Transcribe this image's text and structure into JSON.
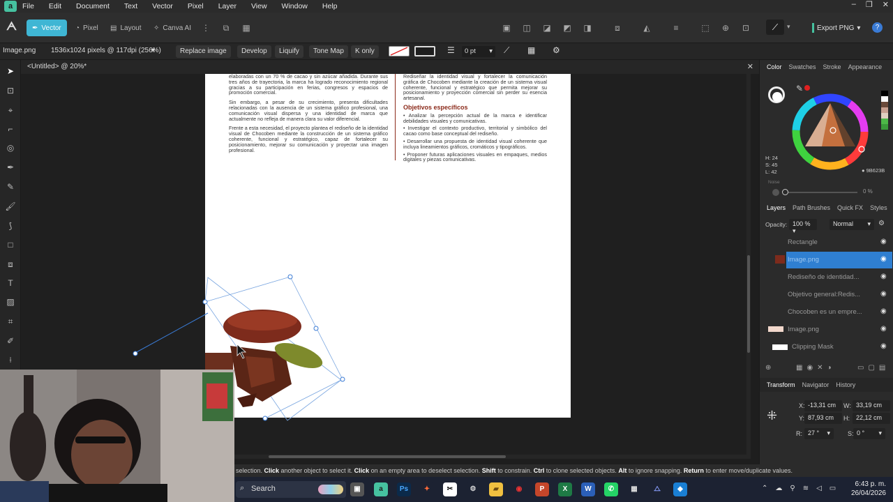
{
  "menubar": {
    "items": [
      "File",
      "Edit",
      "Document",
      "Text",
      "Vector",
      "Pixel",
      "Layer",
      "View",
      "Window",
      "Help"
    ],
    "window_controls": [
      "–",
      "❐",
      "✕"
    ]
  },
  "toolbar": {
    "personas": [
      "Vector",
      "Pixel",
      "Layout",
      "Canva AI"
    ],
    "export_label": "Export PNG"
  },
  "contextbar": {
    "layer_name": "Image.png",
    "dimensions": "1536x1024 pixels @ 117dpi (256%)",
    "replace_image": "Replace image",
    "develop": "Develop",
    "liquify": "Liquify",
    "tone_map": "Tone Map",
    "k_only": "K only",
    "stroke_width": "0 pt"
  },
  "doctab": {
    "title": "<Untitled> @ 20%*",
    "close": "✕"
  },
  "page": {
    "left_col": [
      "elaboradas con un 70 % de cacao y sin azúcar añadida. Durante sus tres años de trayectoria, la marca ha logrado reconocimiento regional gracias a su participación en ferias, congresos y espacios de promoción comercial.",
      "Sin embargo, a pesar de su crecimiento, presenta dificultades relacionadas con la ausencia de un sistema gráfico profesional, una comunicación visual dispersa y una identidad de marca que actualmente no refleja de manera clara su valor diferencial.",
      "Frente a esta necesidad, el proyecto plantea el rediseño de la identidad visual de Chocoben mediante la construcción de un sistema gráfico coherente, funcional y estratégico, capaz de fortalecer su posicionamiento, mejorar su comunicación y proyectar una imagen profesional."
    ],
    "right_top": "Rediseñar la identidad visual y fortalecer la comunicación gráfica de Chocoben mediante la creación de un sistema visual coherente, funcional y estratégico que permita mejorar su posicionamiento y proyección comercial sin perder su esencia artesanal.",
    "objectives_title": "Objetivos específicos",
    "objectives": [
      "• Analizar la percepción actual de la marca e identificar debilidades visuales y comunicativas.",
      "• Investigar el contexto productivo, territorial y simbólico del cacao como base conceptual del rediseño.",
      "• Desarrollar una propuesta de identidad visual coherente que incluya lineamientos gráficos, cromáticos y tipográficos.",
      "• Proponer futuras aplicaciones visuales en empaques, medios digitales y piezas comunicativas."
    ]
  },
  "color_panel": {
    "tabs": [
      "Color",
      "Swatches",
      "Stroke",
      "Appearance"
    ],
    "h": "H: 24",
    "s": "S: 45",
    "l": "L: 42",
    "hex": "9B623B",
    "noise_label": "Noise",
    "noise_value": "0 %",
    "accent": "#9b623b"
  },
  "layers_panel": {
    "tabs": [
      "Layers",
      "Path Brushes",
      "Quick FX",
      "Styles"
    ],
    "opacity_label": "Opacity:",
    "opacity_value": "100 %",
    "blend_mode": "Normal",
    "layers": [
      "Rectangle",
      "Image.png",
      "Rediseño de identidad...",
      "Objetivo general:Redis...",
      "Chocoben es un empre...",
      "Image.png",
      "Clipping Mask"
    ]
  },
  "transform_panel": {
    "tabs": [
      "Transform",
      "Navigator",
      "History"
    ],
    "x_label": "X:",
    "x": "-13,31 cm",
    "w_label": "W:",
    "w": "33,19 cm",
    "y_label": "Y:",
    "y": "87,93 cm",
    "h_label": "H:",
    "h": "22,12 cm",
    "r_label": "R:",
    "r": "27 °",
    "s_label": "S:",
    "s": "0 °"
  },
  "statusbar": {
    "t1": "selection. ",
    "k1": "Click",
    "t2": " another object to select it. ",
    "k2": "Click",
    "t3": " on an empty area to deselect selection. ",
    "k3": "Shift",
    "t4": " to constrain. ",
    "k4": "Ctrl",
    "t5": " to clone selected objects. ",
    "k5": "Alt",
    "t6": " to ignore snapping. ",
    "k6": "Return",
    "t7": " to enter move/duplicate values."
  },
  "taskbar": {
    "search": "Search",
    "time": "6:43 p. m.",
    "date": "26/04/2026"
  }
}
